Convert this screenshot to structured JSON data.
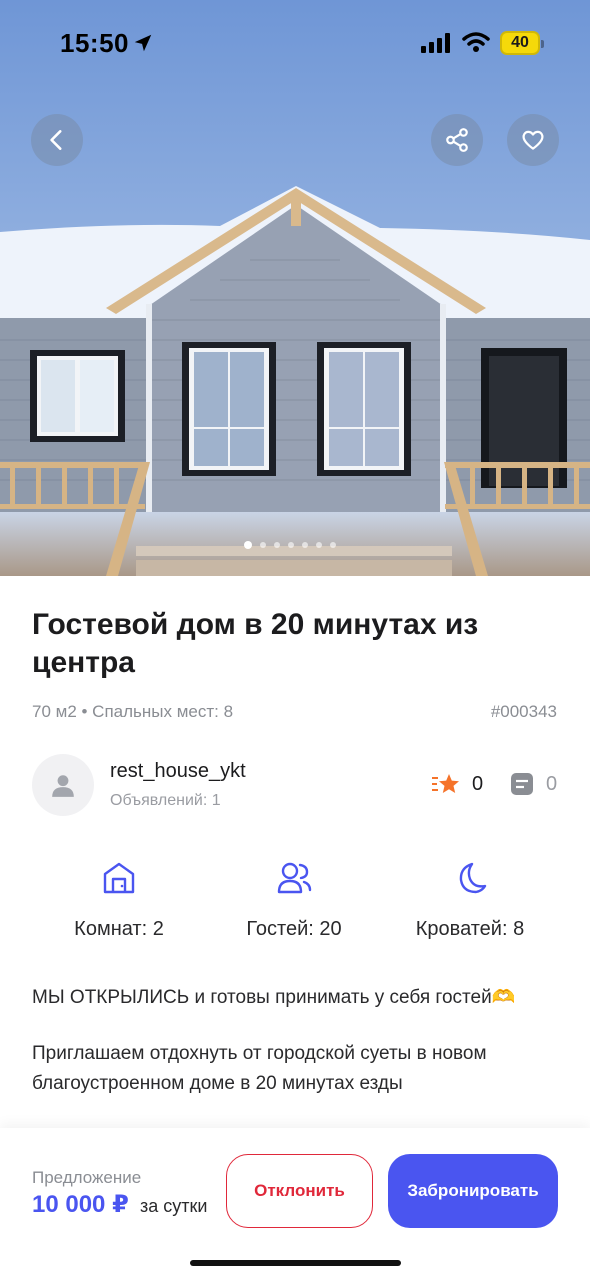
{
  "status_bar": {
    "time": "15:50",
    "battery": "40",
    "icons": [
      "location-arrow-icon",
      "cellular-signal-icon",
      "wifi-icon",
      "battery-icon"
    ]
  },
  "gallery": {
    "photo_count": 7,
    "active_index": 0,
    "buttons": [
      "back-icon",
      "share-icon",
      "heart-icon"
    ]
  },
  "listing": {
    "title": "Гостевой дом в 20 минутах из центра",
    "meta": "70 м2 • Спальных мест: 8",
    "id": "#000343"
  },
  "host": {
    "name": "rest_house_ykt",
    "ads": "Объявлений: 1",
    "rating": "0",
    "reviews": "0"
  },
  "features": [
    {
      "icon": "house-icon",
      "label": "Комнат: 2"
    },
    {
      "icon": "guests-icon",
      "label": "Гостей: 20"
    },
    {
      "icon": "moon-icon",
      "label": "Кроватей: 8"
    }
  ],
  "description": {
    "p1": "МЫ ОТКРЫЛИСЬ и готовы принимать у себя гостей🫶",
    "p2": "Приглашаем отдохнуть от городской суеты в новом благоустроенном доме в 20 минутах езды"
  },
  "offer": {
    "label": "Предложение",
    "price": "10 000 ₽",
    "period": "за сутки",
    "decline": "Отклонить",
    "book": "Забронировать"
  },
  "colors": {
    "accent": "#4a55f0",
    "decline": "#e0283a",
    "star": "#f5732a",
    "sky": "#7c9fd6"
  }
}
